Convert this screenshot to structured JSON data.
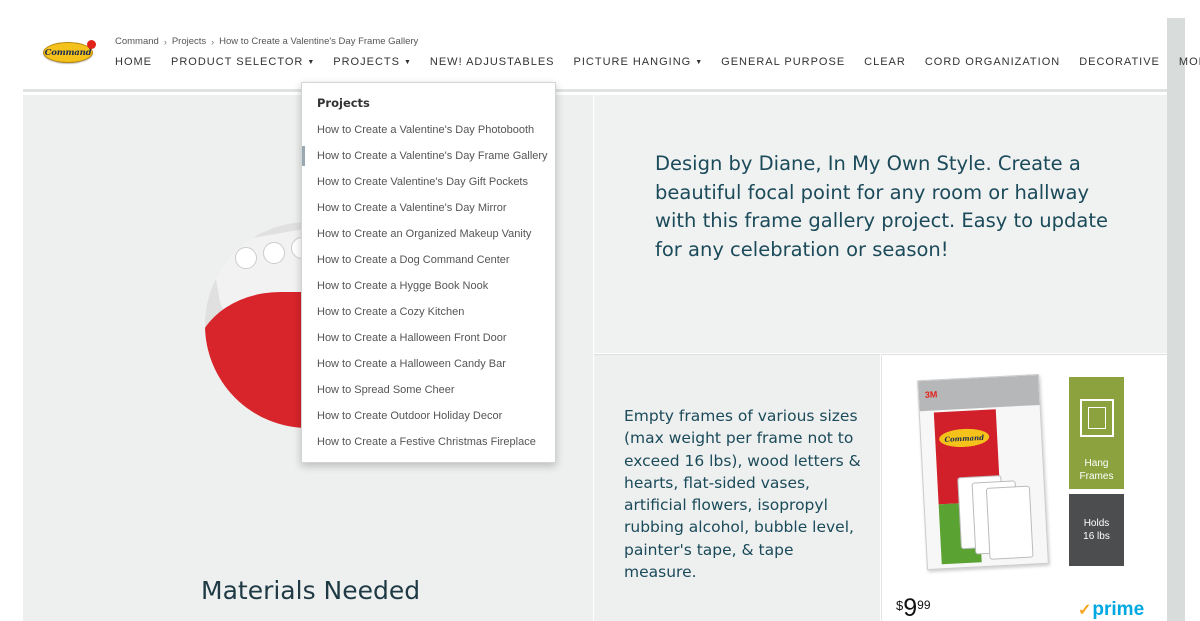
{
  "brand": {
    "logo_text": "Command"
  },
  "breadcrumb": [
    "Command",
    "Projects",
    "How to Create a Valentine's Day Frame Gallery"
  ],
  "nav": [
    {
      "label": "HOME",
      "caret": false
    },
    {
      "label": "PRODUCT SELECTOR",
      "caret": true
    },
    {
      "label": "PROJECTS",
      "caret": true
    },
    {
      "label": "NEW! ADJUSTABLES",
      "caret": false
    },
    {
      "label": "PICTURE HANGING",
      "caret": true
    },
    {
      "label": "GENERAL PURPOSE",
      "caret": false
    },
    {
      "label": "CLEAR",
      "caret": false
    },
    {
      "label": "CORD ORGANIZATION",
      "caret": false
    },
    {
      "label": "DECORATIVE",
      "caret": false
    },
    {
      "label": "MORE",
      "caret": true
    }
  ],
  "dropdown": {
    "title": "Projects",
    "active_index": 1,
    "items": [
      "How to Create a Valentine's Day Photobooth",
      "How to Create a Valentine's Day Frame Gallery",
      "How to Create Valentine's Day Gift Pockets",
      "How to Create a Valentine's Day Mirror",
      "How to Create an Organized Makeup Vanity",
      "How to Create a Dog Command Center",
      "How to Create a Hygge Book Nook",
      "How to Create a Cozy Kitchen",
      "How to Create a Halloween Front Door",
      "How to Create a Halloween Candy Bar",
      "How to Spread Some Cheer",
      "How to Create Outdoor Holiday Decor",
      "How to Create a Festive Christmas Fireplace"
    ]
  },
  "main": {
    "quote": "Design by Diane, In My Own Style. Create a beautiful focal point for any room or hallway with this frame gallery project. Easy to update for any celebration or season!",
    "materials_title": "Materials Needed",
    "materials_text": "Empty frames of various sizes (max weight per frame not to exceed 16 lbs), wood letters & hearts, flat-sided vases, artificial flowers, isopropyl rubbing alcohol, bubble level, painter's tape, & tape measure."
  },
  "product": {
    "package_brand": "3M",
    "package_logo": "Command",
    "badge_hang": [
      "Hang",
      "Frames"
    ],
    "badge_holds": [
      "Holds",
      "16 lbs"
    ],
    "price_symbol": "$",
    "price_dollars": "9",
    "price_cents": "99",
    "prime_label": "prime"
  },
  "colors": {
    "text_teal": "#1b4a5a",
    "badge_green": "#8ba23f",
    "badge_gray": "#4b4d4f",
    "prime_blue": "#00a8e1",
    "prime_check": "#f7a41d"
  },
  "icons": {
    "caret": "caret-down-icon",
    "breadcrumb_sep": "chevron-right-icon",
    "frame": "frame-icon",
    "prime_check": "check-icon"
  }
}
